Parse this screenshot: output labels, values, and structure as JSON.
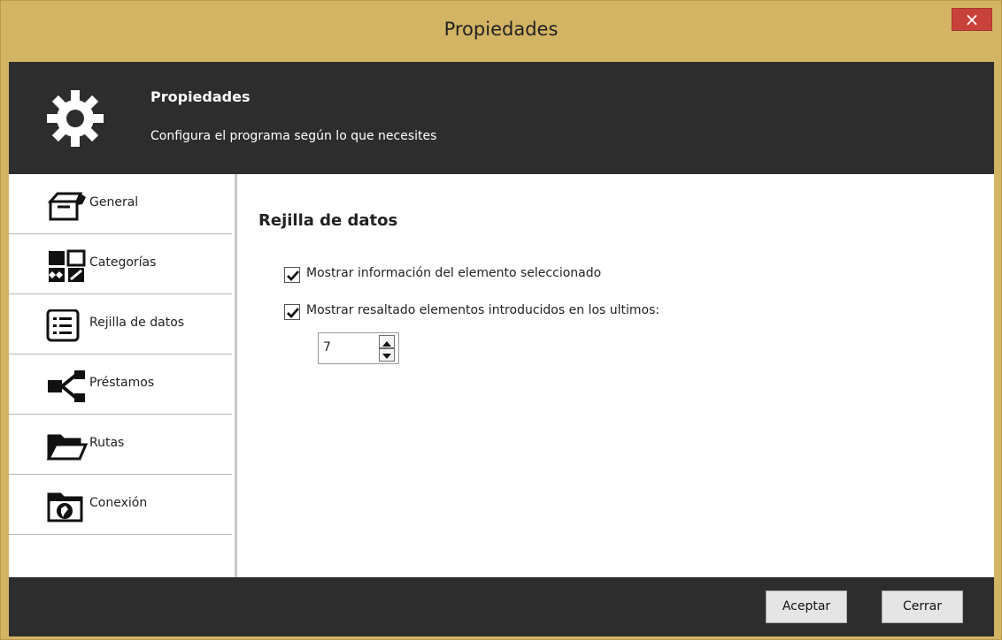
{
  "window": {
    "title": "Propiedades",
    "close_label": "×"
  },
  "header": {
    "icon": "gear-icon",
    "title": "Propiedades",
    "subtitle": "Configura el programa según lo que necesites"
  },
  "sidebar": {
    "items": [
      {
        "label": "General",
        "icon": "box-icon"
      },
      {
        "label": "Categorías",
        "icon": "categories-icon"
      },
      {
        "label": "Rejilla de datos",
        "icon": "list-icon"
      },
      {
        "label": "Préstamos",
        "icon": "share-icon"
      },
      {
        "label": "Rutas",
        "icon": "folder-icon"
      },
      {
        "label": "Conexión",
        "icon": "globe-folder-icon"
      }
    ]
  },
  "main": {
    "section_title": "Rejilla de datos",
    "checkboxes": [
      {
        "label": "Mostrar información del elemento seleccionado",
        "checked": true
      },
      {
        "label": "Mostrar resaltado elementos introducidos en los ultimos:",
        "checked": true
      }
    ],
    "days_value": "7"
  },
  "footer": {
    "accept_label": "Aceptar",
    "close_label": "Cerrar"
  },
  "colors": {
    "frame": "#d3b464",
    "header": "#2d2d2d",
    "close": "#c9423a"
  }
}
